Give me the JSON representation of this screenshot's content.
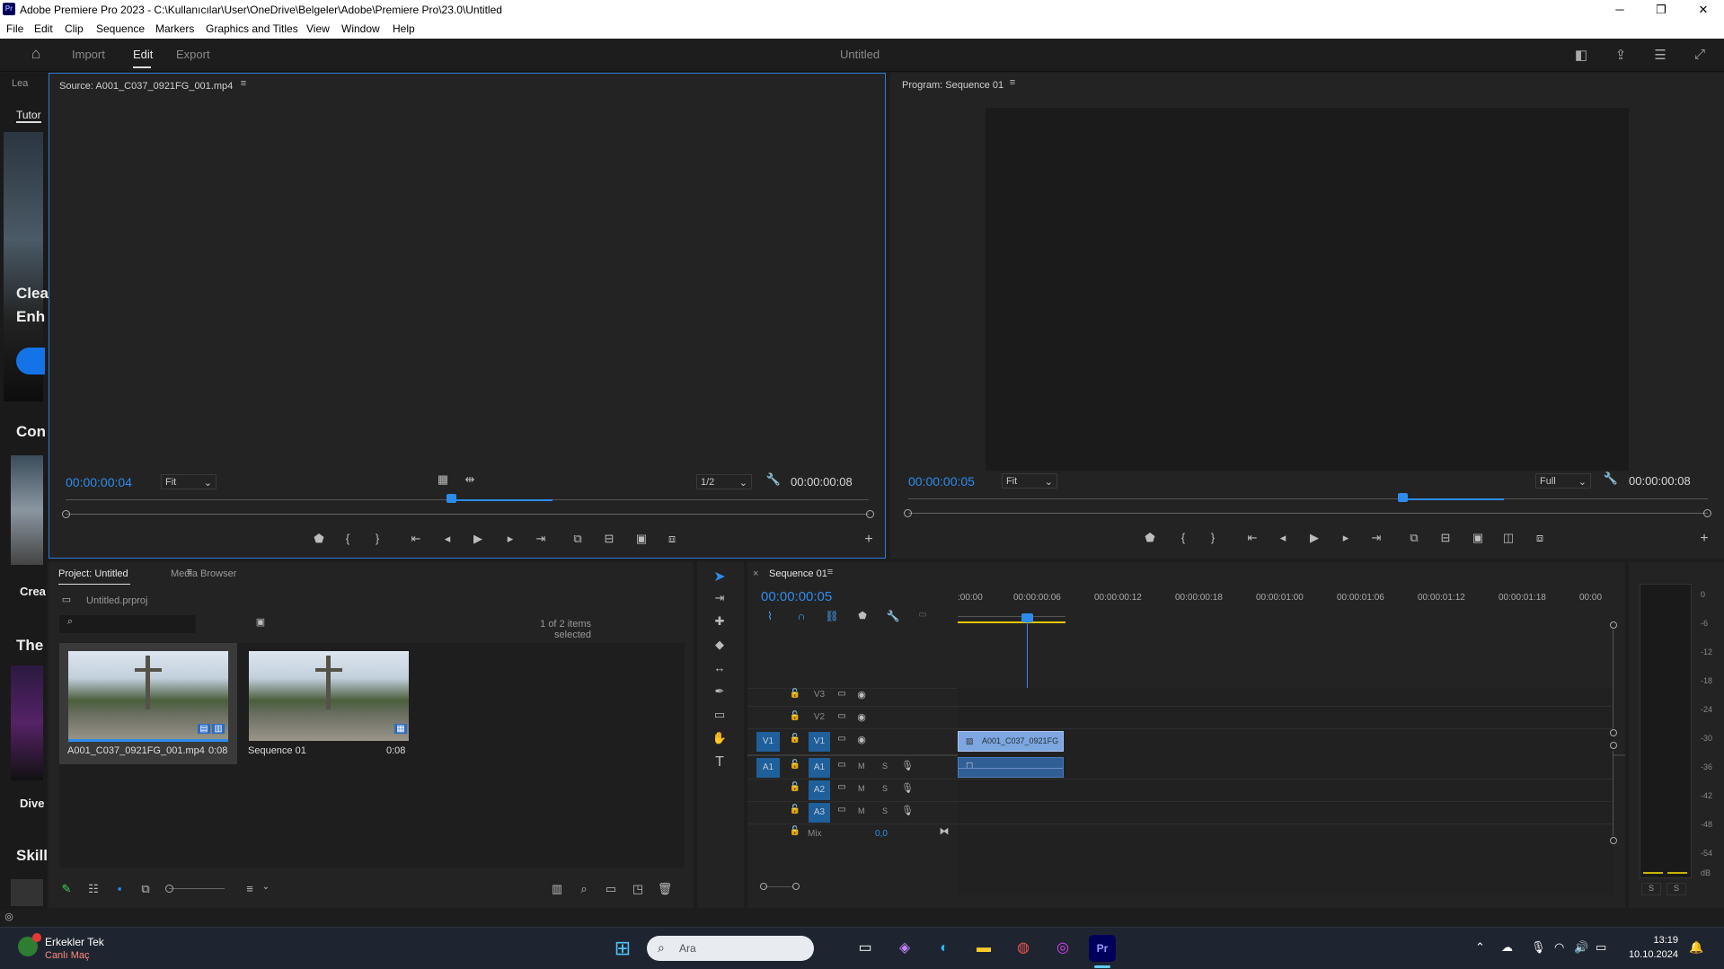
{
  "window": {
    "title": "Adobe Premiere Pro 2023 - C:\\Kullanıcılar\\User\\OneDrive\\Belgeler\\Adobe\\Premiere Pro\\23.0\\Untitled",
    "app_badge": "Pr"
  },
  "menu": [
    "File",
    "Edit",
    "Clip",
    "Sequence",
    "Markers",
    "Graphics and Titles",
    "View",
    "Window",
    "Help"
  ],
  "header": {
    "tabs": [
      "Import",
      "Edit",
      "Export"
    ],
    "active_tab": "Edit",
    "project_name": "Untitled"
  },
  "left_panel": {
    "tab_a": "Lea",
    "tab_b": "Tutor",
    "texts": [
      "Clea",
      "Enh",
      "Con",
      "Crea",
      "The",
      "Dive",
      "Skill"
    ]
  },
  "source_monitor": {
    "title": "Source: A001_C037_0921FG_001.mp4",
    "timecode": "00:00:00:04",
    "fit": "Fit",
    "resolution": "1/2",
    "duration": "00:00:00:08"
  },
  "program_monitor": {
    "title": "Program: Sequence 01",
    "timecode": "00:00:00:05",
    "fit": "Fit",
    "resolution": "Full",
    "duration": "00:00:00:08"
  },
  "project": {
    "tab_active": "Project: Untitled",
    "tab_other": "Media Browser",
    "file": "Untitled.prproj",
    "selection_info": "1 of 2 items selected",
    "items": [
      {
        "name": "A001_C037_0921FG_001.mp4",
        "duration": "0:08"
      },
      {
        "name": "Sequence 01",
        "duration": "0:08"
      }
    ]
  },
  "timeline": {
    "tab": "Sequence 01",
    "timecode": "00:00:00:05",
    "ruler": [
      ":00:00",
      "00:00:00:06",
      "00:00:00:12",
      "00:00:00:18",
      "00:00:01:00",
      "00:00:01:06",
      "00:00:01:12",
      "00:00:01:18",
      "00:00"
    ],
    "video_tracks": [
      "V3",
      "V2",
      "V1"
    ],
    "audio_tracks": [
      "A1",
      "A2",
      "A3"
    ],
    "source_v": "V1",
    "source_a": "A1",
    "mix_label": "Mix",
    "mix_value": "0,0",
    "clip_name": "A001_C037_0921FG",
    "m_label": "M",
    "s_label": "S"
  },
  "audio_meter": {
    "db": [
      "0",
      "-6",
      "-12",
      "-18",
      "-24",
      "-30",
      "-36",
      "-42",
      "-48",
      "-54",
      "dB"
    ],
    "solo": [
      "S",
      "S"
    ]
  },
  "taskbar": {
    "notif_title": "Erkekler Tek",
    "notif_sub": "Canlı Maç",
    "search_placeholder": "Ara",
    "time": "13:19",
    "date": "10.10.2024"
  }
}
